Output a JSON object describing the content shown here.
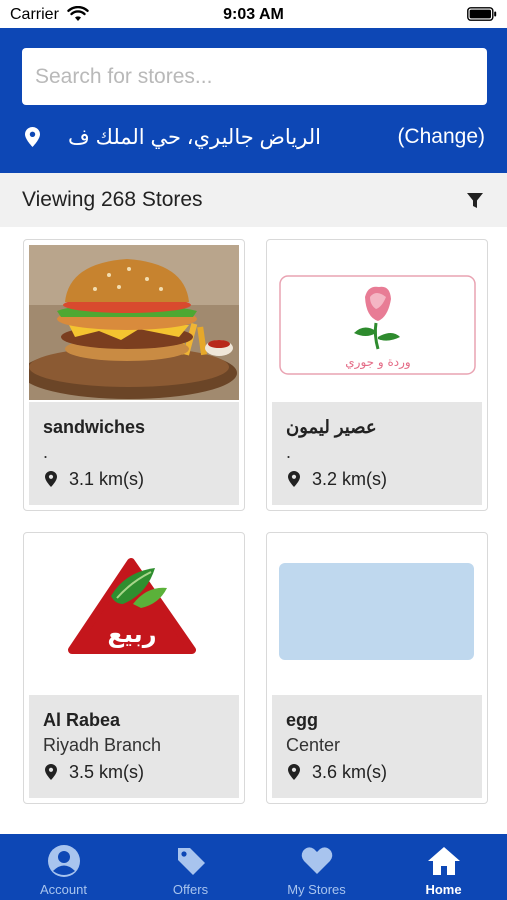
{
  "status_bar": {
    "carrier": "Carrier",
    "time": "9:03 AM"
  },
  "header": {
    "search_placeholder": "Search for stores...",
    "location": "الرياض جاليري، حي الملك ف",
    "change_label": "(Change)"
  },
  "count_bar": {
    "text": "Viewing 268 Stores"
  },
  "stores": [
    {
      "name": "sandwiches",
      "subtitle": ".",
      "distance": "3.1 km(s)"
    },
    {
      "name": "عصير ليمون",
      "subtitle": ".",
      "distance": "3.2 km(s)",
      "logo_text": "وردة و جوري"
    },
    {
      "name": "Al Rabea",
      "subtitle": "Riyadh Branch",
      "distance": "3.5 km(s)",
      "logo_text": "ربيع"
    },
    {
      "name": "egg",
      "subtitle": "Center",
      "distance": "3.6 km(s)",
      "placeholder_color": "#bfd8ee"
    }
  ],
  "tabbar": {
    "tabs": [
      {
        "label": "Account",
        "icon": "account-icon"
      },
      {
        "label": "Offers",
        "icon": "tag-icon"
      },
      {
        "label": "My Stores",
        "icon": "heart-icon"
      },
      {
        "label": "Home",
        "icon": "home-icon",
        "active": true
      }
    ]
  },
  "colors": {
    "primary": "#0d47b5",
    "tab_inactive": "#a8c4ee",
    "card_info_bg": "#e6e6e6"
  }
}
